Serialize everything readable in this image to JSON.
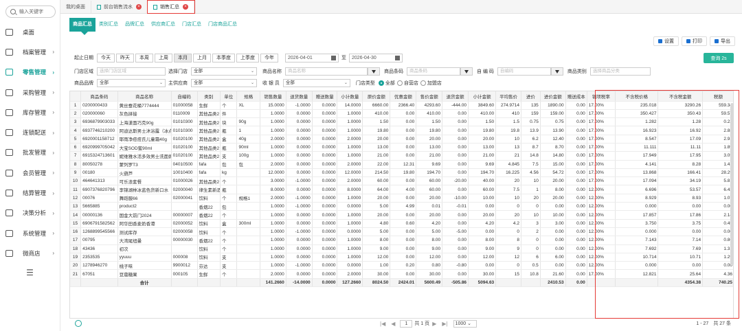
{
  "sidebar": {
    "search_placeholder": "输入关键字",
    "items": [
      {
        "label": "桌面",
        "icon": "monitor-icon",
        "arrow": ""
      },
      {
        "label": "档案管理",
        "icon": "folder-icon",
        "arrow": "›"
      },
      {
        "label": "零售管理",
        "icon": "retail-icon",
        "arrow": "›",
        "active": true
      },
      {
        "label": "采购管理",
        "icon": "cart-icon",
        "arrow": "›"
      },
      {
        "label": "库存管理",
        "icon": "warehouse-icon",
        "arrow": "›"
      },
      {
        "label": "连锁配送",
        "icon": "truck-icon",
        "arrow": "›"
      },
      {
        "label": "批发管理",
        "icon": "wholesale-icon",
        "arrow": "›"
      },
      {
        "label": "会员管理",
        "icon": "user-icon",
        "arrow": "›"
      },
      {
        "label": "结算管理",
        "icon": "settle-icon",
        "arrow": "›"
      },
      {
        "label": "决策分析",
        "icon": "chart-icon",
        "arrow": "›"
      },
      {
        "label": "系统管理",
        "icon": "gear-icon",
        "arrow": "›"
      },
      {
        "label": "微商店",
        "icon": "shop-icon",
        "arrow": "›"
      }
    ],
    "collapse": "☰"
  },
  "page_tabs": [
    {
      "label": "我的桌面",
      "closable": false
    },
    {
      "label": "前台销售流水",
      "closable": true
    },
    {
      "label": "销售汇总",
      "closable": true,
      "active": true
    }
  ],
  "sub_tabs": [
    "商品汇总",
    "类别汇总",
    "品牌汇总",
    "供应商汇总",
    "门店汇总",
    "门店商品汇总"
  ],
  "toolbar": {
    "settings": "设置",
    "print": "打印",
    "export": "导出"
  },
  "date_filter": {
    "label": "起止日期",
    "quick": [
      "今天",
      "昨天",
      "本周",
      "上周",
      "本月",
      "上月",
      "本季度",
      "上季度",
      "今年"
    ],
    "selected": "本月",
    "start": "2026-04-01",
    "to": "至",
    "end": "2026-04-30"
  },
  "query_button": "查询 2s",
  "filters": {
    "store_area": {
      "label": "门店区域",
      "placeholder": "选择门店区域"
    },
    "store": {
      "label": "选择门店",
      "value": "全部"
    },
    "product_name": {
      "label": "商品名称",
      "placeholder": "商品名称"
    },
    "product_code": {
      "label": "商品条码",
      "placeholder": "商品条码"
    },
    "own_code": {
      "label": "自 编 码",
      "placeholder": "自编码"
    },
    "category": {
      "label": "商品类别",
      "placeholder": "选择商品分类"
    },
    "brand": {
      "label": "商品品牌",
      "value": "全部"
    },
    "supplier": {
      "label": "主供应商",
      "value": "全部"
    },
    "cashier": {
      "label": "收 银 员",
      "value": "全部"
    },
    "store_type": {
      "label": "门店类型",
      "options": [
        "全部",
        "自营店",
        "加盟店"
      ],
      "selected": "全部"
    }
  },
  "table": {
    "columns": [
      "",
      "商品条码",
      "商品名称",
      "自编码",
      "类别",
      "单位",
      "规格",
      "销售数量",
      "退货数量",
      "赠送数量",
      "小计数量",
      "原价金额",
      "优惠金额",
      "售价金额",
      "退货金额",
      "小计金额",
      "平均售价",
      "进价",
      "进价金额",
      "赠送成本",
      "销项税率",
      "不含税价格",
      "不含税金额",
      "税额"
    ],
    "rows": [
      [
        "1",
        "0200000433",
        "黄丝蚕花桶7774444",
        "01000058",
        "生鲜",
        "个",
        "XL",
        "15.0000",
        "-1.0000",
        "0.0000",
        "14.0000",
        "6660.00",
        "2366.40",
        "4293.60",
        "-444.00",
        "3849.60",
        "274.9714",
        "135",
        "1890.00",
        "0.00",
        "17.00%",
        "235.018",
        "3290.26",
        "559.34"
      ],
      [
        "2",
        "020000060",
        "灰色拼接",
        "0110009",
        "其他品类2",
        "件",
        "",
        "1.0000",
        "0.0000",
        "0.0000",
        "1.0000",
        "410.00",
        "0.00",
        "410.00",
        "0.00",
        "410.00",
        "410",
        "159",
        "159.00",
        "0.00",
        "17.00%",
        "350.427",
        "350.43",
        "59.57"
      ],
      [
        "3",
        "6936879903033",
        "上海漾面巧克90g",
        "01010300",
        "其他品类2",
        "块",
        "90g",
        "1.0000",
        "0.0000",
        "0.0000",
        "1.0000",
        "1.50",
        "0.00",
        "1.50",
        "0.00",
        "1.50",
        "1.5",
        "0.75",
        "0.75",
        "0.00",
        "17.00%",
        "1.282",
        "1.28",
        "0.22"
      ],
      [
        "4",
        "6937746210200",
        "阿迪达斯男士沐浴露（冰点）",
        "01010300",
        "其他品类2",
        "瓶",
        "1",
        "1.0000",
        "0.0000",
        "0.0000",
        "1.0000",
        "19.80",
        "0.00",
        "19.80",
        "0.00",
        "19.80",
        "19.8",
        "13.9",
        "13.90",
        "0.00",
        "17.00%",
        "16.923",
        "16.92",
        "2.88"
      ],
      [
        "5",
        "6920001158712",
        "耶雨净痘痘氏儿童霜40g",
        "01020100",
        "其他品类2",
        "盒",
        "40g",
        "2.0000",
        "0.0000",
        "0.0000",
        "2.0000",
        "20.00",
        "0.00",
        "20.00",
        "0.00",
        "20.00",
        "10",
        "6.2",
        "12.40",
        "0.00",
        "17.00%",
        "8.547",
        "17.09",
        "2.91"
      ],
      [
        "6",
        "6920999705042",
        "大宝SOD蜜90ml",
        "01020100",
        "其他品类2",
        "瓶",
        "90ml",
        "1.0000",
        "0.0000",
        "0.0000",
        "1.0000",
        "13.00",
        "0.00",
        "13.00",
        "0.00",
        "13.00",
        "13",
        "8.7",
        "8.70",
        "0.00",
        "17.00%",
        "11.111",
        "11.11",
        "1.89"
      ],
      [
        "7",
        "6915324713601",
        "妮维雅水活多效男士洗面奶100g",
        "01020100",
        "其他品类2",
        "支",
        "100g",
        "1.0000",
        "0.0000",
        "0.0000",
        "1.0000",
        "21.00",
        "0.00",
        "21.00",
        "0.00",
        "21.00",
        "21",
        "14.8",
        "14.80",
        "0.00",
        "17.00%",
        "17.949",
        "17.95",
        "3.05"
      ],
      [
        "8",
        "80050278",
        "蒙列罗T3",
        "04010500",
        "fafa",
        "包",
        "包",
        "2.0000",
        "0.0000",
        "0.0000",
        "2.0000",
        "22.00",
        "12.31",
        "9.69",
        "0.00",
        "9.69",
        "4.845",
        "7.5",
        "15.00",
        "0.00",
        "17.00%",
        "4.141",
        "8.28",
        "1.41"
      ],
      [
        "9",
        "00180",
        "火葫芦",
        "10010400",
        "fafa",
        "kg",
        "",
        "12.0000",
        "0.0000",
        "0.0000",
        "12.0000",
        "214.50",
        "19.80",
        "194.70",
        "0.00",
        "194.70",
        "16.225",
        "4.56",
        "54.72",
        "0.00",
        "17.00%",
        "13.868",
        "166.41",
        "28.29"
      ],
      [
        "10",
        "464641313",
        "可乐浪套餐",
        "01000026",
        "其他品类2",
        "个",
        "",
        "3.0000",
        "-1.0000",
        "0.0000",
        "2.0000",
        "60.00",
        "0.00",
        "60.00",
        "-20.00",
        "40.00",
        "20",
        "10",
        "20.00",
        "0.00",
        "17.00%",
        "17.094",
        "34.19",
        "5.81"
      ],
      [
        "11",
        "6907376820796",
        "李锦湖林冰蓝色货新口水",
        "02000040",
        "律生素新酒",
        "瓶",
        "",
        "8.0000",
        "0.0000",
        "0.0000",
        "8.0000",
        "64.00",
        "4.00",
        "60.00",
        "0.00",
        "60.00",
        "7.5",
        "1",
        "8.00",
        "0.00",
        "12.00%",
        "6.696",
        "53.57",
        "6.43"
      ],
      [
        "12",
        "00076",
        "舞蹈服66",
        "02000041",
        "饮料",
        "个",
        "规格1",
        "2.0000",
        "-1.0000",
        "0.0000",
        "1.0000",
        "20.00",
        "0.00",
        "20.00",
        "-10.00",
        "10.00",
        "10",
        "20",
        "20.00",
        "0.00",
        "12.00%",
        "8.929",
        "8.93",
        "1.07"
      ],
      [
        "13",
        "5665885",
        "product2",
        "",
        "香烟22",
        "包",
        "",
        "1.0000",
        "-1.0000",
        "0.0000",
        "0.0000",
        "5.00",
        "4.99",
        "0.01",
        "-0.01",
        "0.00",
        "0",
        "0",
        "0.00",
        "0.00",
        "12.00%",
        "0.000",
        "0.00",
        "0.00"
      ],
      [
        "14",
        "00000136",
        "国金大前门2024",
        "00000007",
        "香烟22",
        "个",
        "",
        "1.0000",
        "0.0000",
        "0.0000",
        "1.0000",
        "20.00",
        "0.00",
        "20.00",
        "0.00",
        "20.00",
        "20",
        "10",
        "10.00",
        "0.00",
        "12.00%",
        "17.857",
        "17.86",
        "2.14"
      ],
      [
        "15",
        "6906791582562",
        "阿华田香麦奶香港",
        "02000052",
        "饮料",
        "盒",
        "300ml",
        "1.0000",
        "0.0000",
        "0.0000",
        "1.0000",
        "4.80",
        "0.60",
        "4.20",
        "0.00",
        "4.20",
        "4.2",
        "3",
        "3.00",
        "0.00",
        "12.00%",
        "3.750",
        "3.75",
        "0.45"
      ],
      [
        "16",
        "1268899545566",
        "测试库存",
        "02000058",
        "饮料",
        "个",
        "",
        "1.0000",
        "-1.0000",
        "0.0000",
        "0.0000",
        "5.00",
        "0.00",
        "5.00",
        "-5.00",
        "0.00",
        "0",
        "2",
        "0.00",
        "0.00",
        "12.00%",
        "0.000",
        "0.00",
        "0.00"
      ],
      [
        "17",
        "00795",
        "大湾尾纽曼",
        "00000030",
        "香烟22",
        "个",
        "",
        "1.0000",
        "0.0000",
        "0.0000",
        "1.0000",
        "8.00",
        "0.00",
        "8.00",
        "0.00",
        "8.00",
        "8",
        "0",
        "0.00",
        "0.00",
        "12.00%",
        "7.143",
        "7.14",
        "0.86"
      ],
      [
        "18",
        "43436",
        "初次",
        "",
        "饮料",
        "个",
        "",
        "1.0000",
        "0.0000",
        "0.0000",
        "1.0000",
        "9.00",
        "0.00",
        "9.00",
        "0.00",
        "9.00",
        "9",
        "0",
        "0.00",
        "0.00",
        "12.00%",
        "7.692",
        "7.69",
        "1.31"
      ],
      [
        "19",
        "2353535",
        "yyuuu",
        "000008",
        "饮料",
        "支",
        "",
        "1.0000",
        "0.0000",
        "0.0000",
        "1.0000",
        "12.00",
        "0.00",
        "12.00",
        "0.00",
        "12.00",
        "12",
        "6",
        "6.00",
        "0.00",
        "12.00%",
        "10.714",
        "10.71",
        "1.29"
      ],
      [
        "20",
        "1278946270",
        "桃子味",
        "9900012",
        "芬达",
        "支",
        "",
        "1.0000",
        "-1.0000",
        "0.0000",
        "0.0000",
        "1.00",
        "0.20",
        "0.80",
        "-0.80",
        "0.00",
        "0",
        "0.5",
        "0.00",
        "0.00",
        "12.00%",
        "0.000",
        "0.00",
        "0.00"
      ],
      [
        "21",
        "67051",
        "豆蔻糖果",
        "000105",
        "生鲜",
        "个",
        "",
        "2.0000",
        "0.0000",
        "0.0000",
        "2.0000",
        "30.00",
        "0.00",
        "30.00",
        "0.00",
        "30.00",
        "15",
        "10.8",
        "21.60",
        "0.00",
        "17.00%",
        "12.821",
        "25.64",
        "4.36"
      ]
    ],
    "footer": [
      "",
      "",
      "合计",
      "",
      "",
      "",
      "",
      "141.2660",
      "-14.0000",
      "0.0000",
      "127.2660",
      "8024.50",
      "2424.01",
      "5600.49",
      "-505.86",
      "5094.63",
      "",
      "",
      "2410.53",
      "0.00",
      "",
      "",
      "4354.38",
      "740.25"
    ]
  },
  "pager": {
    "first": "|◀",
    "prev": "◀",
    "page": "1",
    "of": "共 1 页",
    "next": "▶",
    "last": "▶|",
    "size": "1000 ⌄",
    "info": "1 - 27　共 27 条"
  }
}
